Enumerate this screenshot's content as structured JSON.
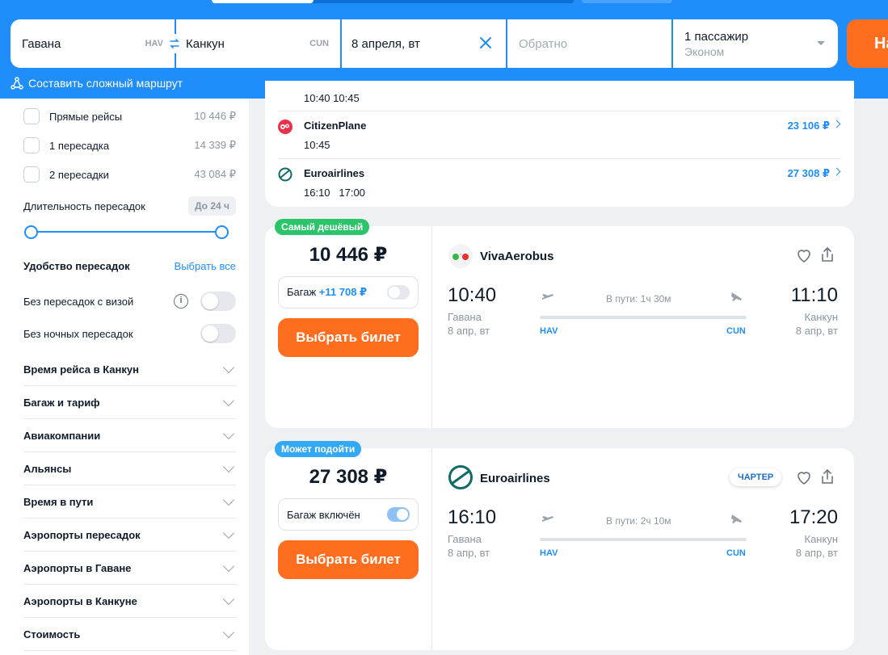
{
  "search": {
    "from_city": "Гавана",
    "from_code": "HAV",
    "to_city": "Канкун",
    "to_code": "CUN",
    "date": "8 апреля, вт",
    "return_placeholder": "Обратно",
    "passengers": "1 пассажир",
    "cabin": "Эконом",
    "search_button_label": "На",
    "complex_route_link": "Составить сложный маршрут"
  },
  "filters": {
    "stops": [
      {
        "label": "Прямые рейсы",
        "price": "10 446 ₽"
      },
      {
        "label": "1 пересадка",
        "price": "14 339 ₽"
      },
      {
        "label": "2 пересадки",
        "price": "43 084 ₽"
      }
    ],
    "layover_duration_label": "Длительность пересадок",
    "layover_duration_badge": "До 24 ч",
    "layover_duration_range": [
      0,
      1
    ],
    "convenience_title": "Удобство пересадок",
    "select_all": "Выбрать все",
    "no_visa_transfers": "Без пересадок с визой",
    "no_night_transfers": "Без ночных пересадок",
    "sections": [
      "Время рейса в Канкун",
      "Багаж и тариф",
      "Авиакомпании",
      "Альянсы",
      "Время в пути",
      "Аэропорты пересадок",
      "Аэропорты в Гаване",
      "Аэропорты в Канкуне",
      "Стоимость"
    ]
  },
  "alt_card": {
    "partial_times": "10:40 10:45",
    "rows": [
      {
        "airline": "CitizenPlane",
        "times": "10:45",
        "price": "23 106 ₽",
        "icon": "citizenplane-logo"
      },
      {
        "airline": "Euroairlines",
        "times": "16:10   17:00",
        "price": "27 308 ₽",
        "icon": "euroairlines-logo"
      }
    ]
  },
  "tickets": [
    {
      "badge": "Самый дешёвый",
      "badge_color": "#2bc46b",
      "price": "10 446 ₽",
      "baggage_label": "Багаж",
      "baggage_extra": "+11 708 ₽",
      "baggage_on": false,
      "buy_label": "Выбрать билет",
      "airline": "VivaAerobus",
      "charter": "",
      "dep_time": "10:40",
      "dep_city": "Гавана",
      "dep_date": "8 апр, вт",
      "duration": "В пути: 1ч 30м",
      "dep_code": "HAV",
      "arr_code": "CUN",
      "arr_time": "11:10",
      "arr_city": "Канкун",
      "arr_date": "8 апр, вт"
    },
    {
      "badge": "Может подойти",
      "badge_color": "#33a8f5",
      "price": "27 308 ₽",
      "baggage_label": "Багаж включён",
      "baggage_extra": "",
      "baggage_on": true,
      "buy_label": "Выбрать билет",
      "airline": "Euroairlines",
      "charter": "ЧАРТЕР",
      "dep_time": "16:10",
      "dep_city": "Гавана",
      "dep_date": "8 апр, вт",
      "duration": "В пути: 2ч 10м",
      "dep_code": "HAV",
      "arr_code": "CUN",
      "arr_time": "17:20",
      "arr_city": "Канкун",
      "arr_date": "8 апр, вт"
    }
  ],
  "colors": {
    "header_blue": "#1f8efa",
    "accent_orange": "#ff6d1f",
    "link_blue": "#1f8efa"
  }
}
